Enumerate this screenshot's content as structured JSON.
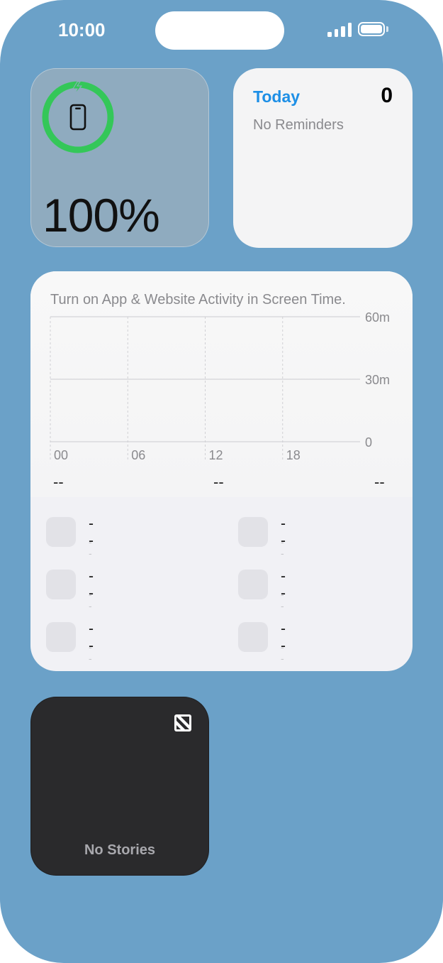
{
  "status_bar": {
    "time": "10:00"
  },
  "battery_widget": {
    "percent": "100%",
    "charge_fraction": 1.0,
    "ring_color": "#34c759"
  },
  "reminders_widget": {
    "title": "Today",
    "count": "0",
    "empty_text": "No Reminders",
    "accent": "#1d8fe6"
  },
  "screen_time_widget": {
    "message": "Turn on App & Website Activity in Screen Time.",
    "y_ticks": [
      "60m",
      "30m",
      "0"
    ],
    "x_ticks": [
      "00",
      "06",
      "12",
      "18"
    ],
    "summary": [
      "--",
      "--",
      "--"
    ],
    "apps": [
      {
        "name": "--",
        "time": "--"
      },
      {
        "name": "--",
        "time": "--"
      },
      {
        "name": "--",
        "time": "--"
      },
      {
        "name": "--",
        "time": "--"
      },
      {
        "name": "--",
        "time": "--"
      },
      {
        "name": "--",
        "time": "--"
      }
    ]
  },
  "news_widget": {
    "empty_text": "No Stories"
  },
  "colors": {
    "wallpaper": "#6ba1c8",
    "news_bg": "#2a2a2c"
  }
}
